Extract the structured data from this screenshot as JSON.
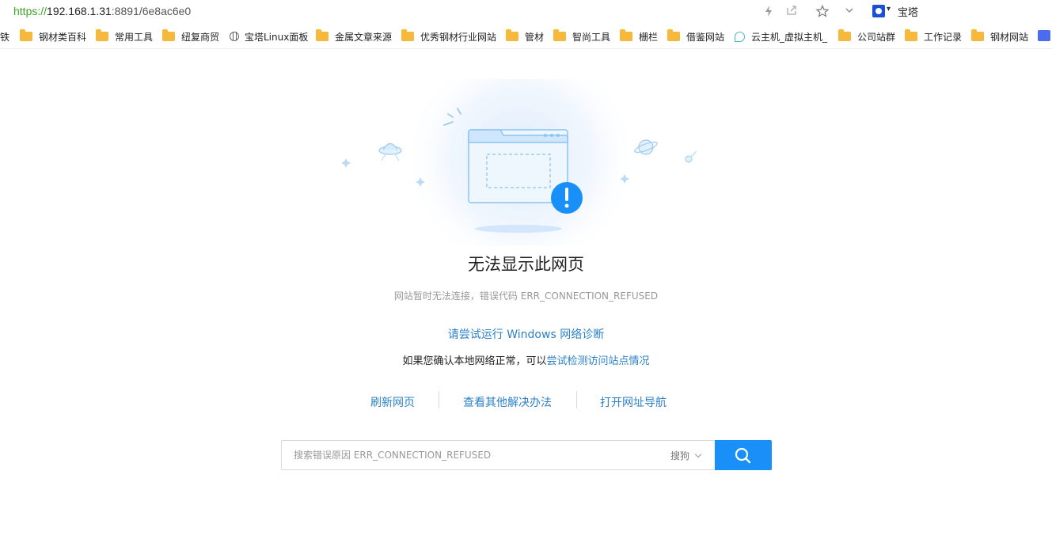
{
  "address_bar": {
    "url_scheme": "https://",
    "url_host": "192.168.1.31",
    "url_rest": ":8891/6e8ac6e0",
    "icons": [
      "lightning-icon",
      "share-icon",
      "star-icon",
      "chevron-down-icon"
    ],
    "extension_label": "宝塔"
  },
  "bookmarks": {
    "items": [
      {
        "label": "铁",
        "icon": "none"
      },
      {
        "label": "钢材类百科",
        "icon": "folder-icon"
      },
      {
        "label": "常用工具",
        "icon": "folder-icon"
      },
      {
        "label": "纽复商贸",
        "icon": "folder-icon"
      },
      {
        "label": "宝塔Linux面板",
        "icon": "globe-icon"
      },
      {
        "label": "金属文章来源",
        "icon": "folder-icon"
      },
      {
        "label": "优秀钢材行业网站",
        "icon": "folder-icon"
      },
      {
        "label": "管材",
        "icon": "folder-icon"
      },
      {
        "label": "智尚工具",
        "icon": "folder-icon"
      },
      {
        "label": "栅栏",
        "icon": "folder-icon"
      },
      {
        "label": "借鉴网站",
        "icon": "folder-icon"
      },
      {
        "label": "云主机_虚拟主机_",
        "icon": "cloud-icon"
      },
      {
        "label": "公司站群",
        "icon": "folder-icon"
      },
      {
        "label": "工作记录",
        "icon": "folder-icon"
      },
      {
        "label": "钢材网站",
        "icon": "folder-icon"
      }
    ]
  },
  "error": {
    "title": "无法显示此网页",
    "subtitle": "网站暂时无法连接，错误代码 ERR_CONNECTION_REFUSED",
    "diagnose_link": "请尝试运行 Windows 网络诊断",
    "check_prefix": "如果您确认本地网络正常，可以",
    "check_link": "尝试检测访问站点情况"
  },
  "actions": {
    "refresh": "刷新网页",
    "other_solutions": "查看其他解决办法",
    "open_nav": "打开网址导航"
  },
  "search": {
    "placeholder": "搜索错误原因 ERR_CONNECTION_REFUSED",
    "engine": "搜狗",
    "button_icon": "search-icon"
  },
  "colors": {
    "link": "#2c81c8",
    "search_button": "#1890f7",
    "url_scheme": "#3aa526",
    "folder": "#f6b93b"
  }
}
